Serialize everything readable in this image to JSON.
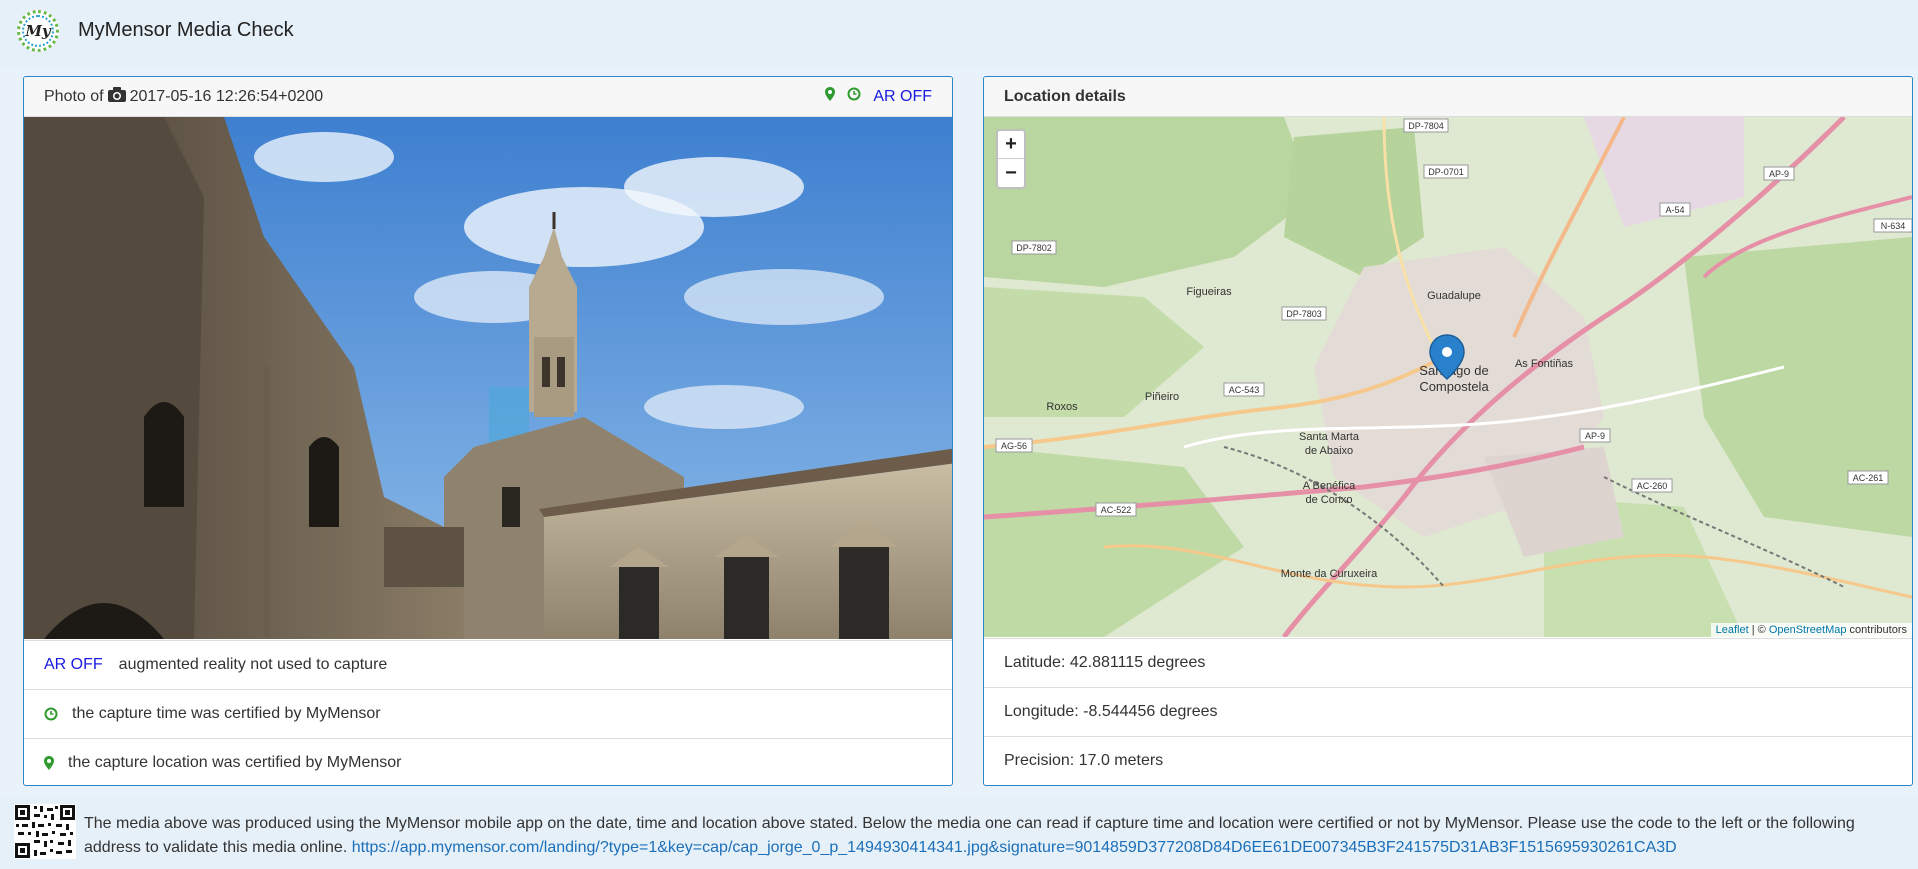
{
  "app": {
    "title": "MyMensor Media Check",
    "logo_text": "My"
  },
  "photo_panel": {
    "header_prefix": "Photo of",
    "timestamp": "2017-05-16 12:26:54+0200",
    "ar_status": "AR OFF",
    "rows": [
      {
        "badge": "AR OFF",
        "text": "augmented reality not used to capture"
      },
      {
        "icon": "clock-icon",
        "text": "the capture time was certified by MyMensor"
      },
      {
        "icon": "map-marker-icon",
        "text": "the capture location was certified by MyMensor"
      }
    ]
  },
  "location_panel": {
    "title": "Location details",
    "latitude": "Latitude: 42.881115 degrees",
    "longitude": "Longitude: -8.544456 degrees",
    "precision": "Precision: 17.0 meters",
    "zoom_in": "+",
    "zoom_out": "−",
    "attribution_leaflet": "Leaflet",
    "attribution_sep": " | © ",
    "attribution_osm": "OpenStreetMap",
    "attribution_suffix": " contributors",
    "map_labels": {
      "city1": "Santiago de",
      "city2": "Compostela",
      "guadalupe": "Guadalupe",
      "figueiras": "Figueiras",
      "as_fontinas": "As Fontiñas",
      "pineiro": "Piñeiro",
      "roxos": "Roxos",
      "santa_marta1": "Santa Marta",
      "santa_marta2": "de Abaixo",
      "benefica1": "A Benéfica",
      "benefica2": "de Conxo",
      "curuxeira": "Monte da Curuxeira",
      "dp7804": "DP-7804",
      "dp0701": "DP-0701",
      "dp7802": "DP-7802",
      "dp7803": "DP-7803",
      "ac543": "AC-543",
      "ag56": "AG-56",
      "ac522": "AC-522",
      "ap9": "AP-9",
      "ap9b": "AP-9",
      "a54": "A-54",
      "ac260": "AC-260",
      "ac261": "AC-261",
      "n634": "N-634"
    }
  },
  "footer": {
    "text": "The media above was produced using the MyMensor mobile app on the date, time and location above stated. Below the media one can read if capture time and location were certified or not by MyMensor. Please use the code to the left or the following address to validate this media online. ",
    "link": "https://app.mymensor.com/landing/?type=1&key=cap/cap_jorge_0_p_1494930414341.jpg&signature=9014859D377208D84D6EE61DE007345B3F241575D31AB3F1515695930261CA3D"
  },
  "colors": {
    "accent_blue": "#2a88c8",
    "ar_blue": "#1a1adf",
    "certified_green": "#2f9a2f",
    "link_blue": "#1c6fb8"
  }
}
